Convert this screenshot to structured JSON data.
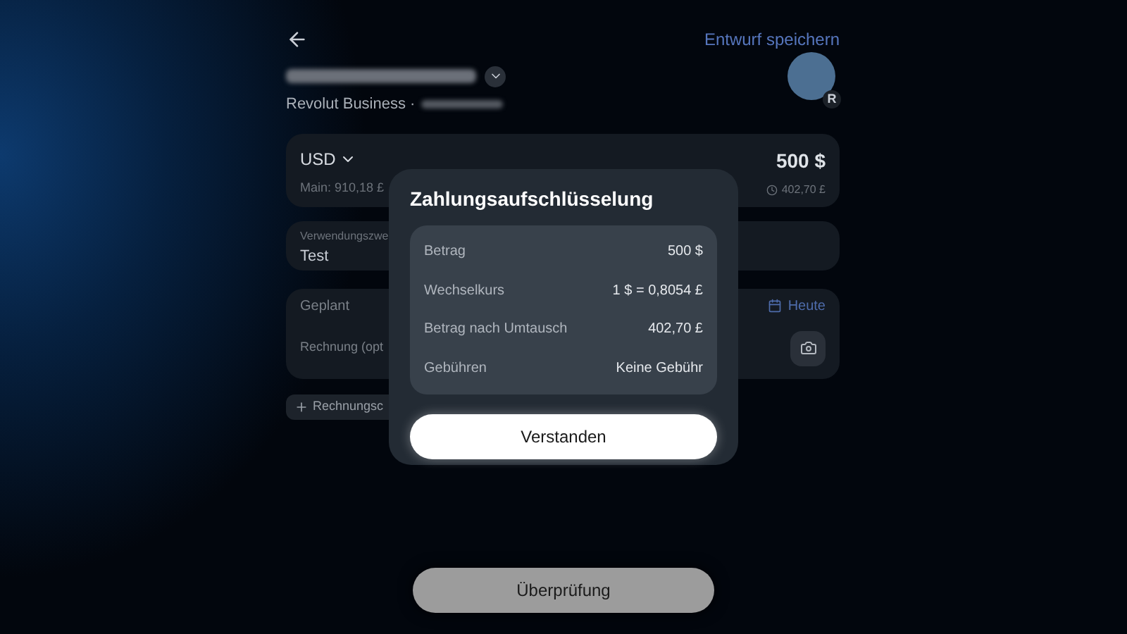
{
  "header": {
    "save_draft": "Entwurf speichern"
  },
  "account": {
    "subtitle": "Revolut Business ·",
    "avatar_badge": "R"
  },
  "amount_card": {
    "currency": "USD",
    "balance": "Main: 910,18 £",
    "amount": "500 $",
    "converted": "402,70 £"
  },
  "reference": {
    "label": "Verwendungszwe",
    "value": "Test"
  },
  "schedule": {
    "label": "Geplant",
    "date": "Heute",
    "invoice_label": "Rechnung (opt"
  },
  "add_chip": {
    "label": "Rechnungsc"
  },
  "review_button": {
    "label": "Überprüfung"
  },
  "dialog": {
    "title": "Zahlungsaufschlüsselung",
    "rows": [
      {
        "label": "Betrag",
        "value": "500 $"
      },
      {
        "label": "Wechselkurs",
        "value": "1 $ = 0,8054 £"
      },
      {
        "label": "Betrag nach Umtausch",
        "value": "402,70 £"
      },
      {
        "label": "Gebühren",
        "value": "Keine Gebühr"
      }
    ],
    "button": "Verstanden"
  }
}
